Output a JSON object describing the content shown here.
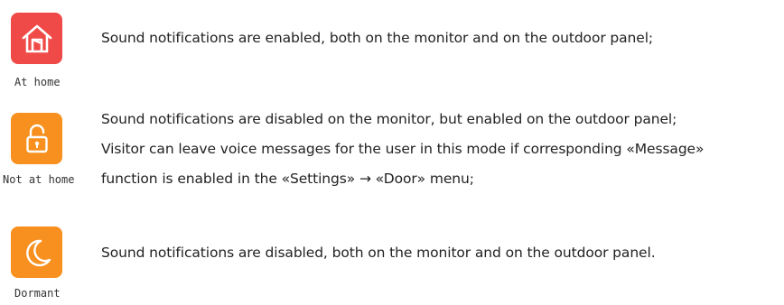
{
  "modes": [
    {
      "label": "At home",
      "icon": "home-icon",
      "color": "#f04a48",
      "lines": [
        "Sound notifications are enabled, both on the monitor and on the outdoor panel;"
      ]
    },
    {
      "label": "Not at home",
      "icon": "unlocked-padlock-icon",
      "color": "#f7901e",
      "lines": [
        "Sound notifications are disabled on the monitor, but enabled on the outdoor panel;",
        "Visitor can leave voice messages for the user in this mode if corresponding «Message»",
        "function is enabled in the «Settings» → «Door» menu;"
      ]
    },
    {
      "label": "Dormant",
      "icon": "moon-icon",
      "color": "#f7901e",
      "lines": [
        "Sound notifications are disabled, both on the monitor and on the outdoor panel."
      ]
    }
  ]
}
